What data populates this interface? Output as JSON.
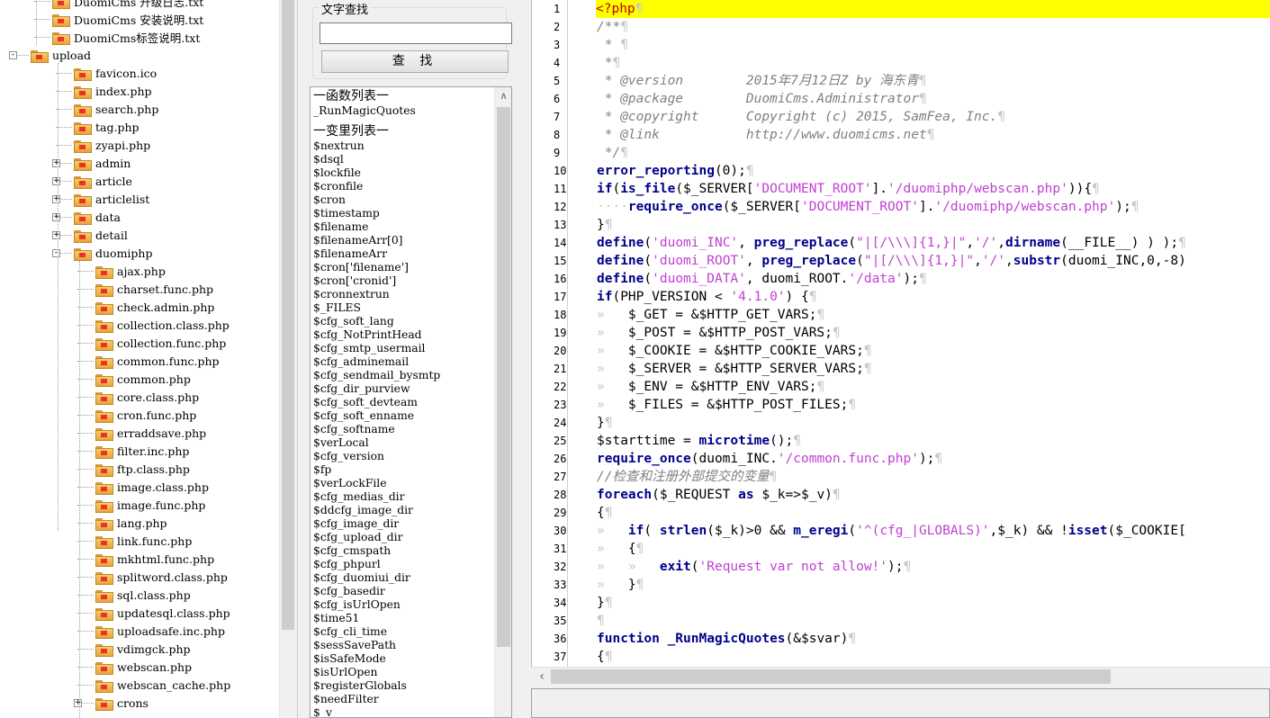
{
  "tree": {
    "items": [
      {
        "label": "DuomiCms 升级日志.txt",
        "indent": 2
      },
      {
        "label": "DuomiCms 安装说明.txt",
        "indent": 2
      },
      {
        "label": "DuomiCms标签说明.txt",
        "indent": 2
      },
      {
        "label": "upload",
        "indent": 1,
        "expander": "-"
      },
      {
        "label": "favicon.ico",
        "indent": 3
      },
      {
        "label": "index.php",
        "indent": 3
      },
      {
        "label": "search.php",
        "indent": 3
      },
      {
        "label": "tag.php",
        "indent": 3
      },
      {
        "label": "zyapi.php",
        "indent": 3
      },
      {
        "label": "admin",
        "indent": 3,
        "expander": "+"
      },
      {
        "label": "article",
        "indent": 3,
        "expander": "+"
      },
      {
        "label": "articlelist",
        "indent": 3,
        "expander": "+"
      },
      {
        "label": "data",
        "indent": 3,
        "expander": "+"
      },
      {
        "label": "detail",
        "indent": 3,
        "expander": "+"
      },
      {
        "label": "duomiphp",
        "indent": 3,
        "expander": "-"
      },
      {
        "label": "ajax.php",
        "indent": 4
      },
      {
        "label": "charset.func.php",
        "indent": 4
      },
      {
        "label": "check.admin.php",
        "indent": 4
      },
      {
        "label": "collection.class.php",
        "indent": 4
      },
      {
        "label": "collection.func.php",
        "indent": 4
      },
      {
        "label": "common.func.php",
        "indent": 4
      },
      {
        "label": "common.php",
        "indent": 4
      },
      {
        "label": "core.class.php",
        "indent": 4
      },
      {
        "label": "cron.func.php",
        "indent": 4
      },
      {
        "label": "erraddsave.php",
        "indent": 4
      },
      {
        "label": "filter.inc.php",
        "indent": 4
      },
      {
        "label": "ftp.class.php",
        "indent": 4
      },
      {
        "label": "image.class.php",
        "indent": 4
      },
      {
        "label": "image.func.php",
        "indent": 4
      },
      {
        "label": "lang.php",
        "indent": 4
      },
      {
        "label": "link.func.php",
        "indent": 4
      },
      {
        "label": "mkhtml.func.php",
        "indent": 4
      },
      {
        "label": "splitword.class.php",
        "indent": 4
      },
      {
        "label": "sql.class.php",
        "indent": 4
      },
      {
        "label": "updatesql.class.php",
        "indent": 4
      },
      {
        "label": "uploadsafe.inc.php",
        "indent": 4
      },
      {
        "label": "vdimgck.php",
        "indent": 4
      },
      {
        "label": "webscan.php",
        "indent": 4
      },
      {
        "label": "webscan_cache.php",
        "indent": 4
      },
      {
        "label": "crons",
        "indent": 4,
        "expander": "+"
      }
    ]
  },
  "search": {
    "group_label": "文字查找",
    "input_value": "",
    "button_label": "查 找"
  },
  "symbols": {
    "functions_header": "一函数列表一",
    "functions": [
      "_RunMagicQuotes"
    ],
    "variables_header": "一变里列表一",
    "variables": [
      "$nextrun",
      "$dsql",
      "$lockfile",
      "$cronfile",
      "$cron",
      "$timestamp",
      "$filename",
      "$filenameArr[0]",
      "$filenameArr",
      "$cron['filename']",
      "$cron['cronid']",
      "$cronnextrun",
      "$_FILES",
      "$cfg_soft_lang",
      "$cfg_NotPrintHead",
      "$cfg_smtp_usermail",
      "$cfg_adminemail",
      "$cfg_sendmail_bysmtp",
      "$cfg_dir_purview",
      "$cfg_soft_devteam",
      "$cfg_soft_enname",
      "$cfg_softname",
      "$verLocal",
      "$cfg_version",
      "$fp",
      "$verLockFile",
      "$cfg_medias_dir",
      "$ddcfg_image_dir",
      "$cfg_image_dir",
      "$cfg_upload_dir",
      "$cfg_cmspath",
      "$cfg_phpurl",
      "$cfg_duomiui_dir",
      "$cfg_basedir",
      "$cfg_isUrlOpen",
      "$time51",
      "$cfg_cli_time",
      "$sessSavePath",
      "$isSafeMode",
      "$isUrlOpen",
      "$registerGlobals",
      "$needFilter",
      "$_v"
    ]
  },
  "editor": {
    "line_numbers": [
      "1",
      "2",
      "3",
      "4",
      "5",
      "6",
      "7",
      "8",
      "9",
      "10",
      "11",
      "12",
      "13",
      "14",
      "15",
      "16",
      "17",
      "18",
      "19",
      "20",
      "21",
      "22",
      "23",
      "24",
      "25",
      "26",
      "27",
      "28",
      "29",
      "30",
      "31",
      "32",
      "33",
      "34",
      "35",
      "36",
      "37"
    ],
    "highlighted_line": 1,
    "lines": [
      [
        [
          "p",
          "<?php"
        ],
        [
          "ws",
          "¶"
        ]
      ],
      [
        [
          "c",
          "/**"
        ],
        [
          "ws",
          "¶"
        ]
      ],
      [
        [
          "c",
          " * "
        ],
        [
          "ws",
          "¶"
        ]
      ],
      [
        [
          "c",
          " *"
        ],
        [
          "ws",
          "¶"
        ]
      ],
      [
        [
          "c",
          " * @version        2015年7月12日Z by 海东青"
        ],
        [
          "ws",
          "¶"
        ]
      ],
      [
        [
          "c",
          " * @package        DuomiCms.Administrator"
        ],
        [
          "ws",
          "¶"
        ]
      ],
      [
        [
          "c",
          " * @copyright      Copyright (c) 2015, SamFea, Inc."
        ],
        [
          "ws",
          "¶"
        ]
      ],
      [
        [
          "c",
          " * @link           http://www.duomicms.net"
        ],
        [
          "ws",
          "¶"
        ]
      ],
      [
        [
          "c",
          " */"
        ],
        [
          "ws",
          "¶"
        ]
      ],
      [
        [
          "k",
          "error_reporting"
        ],
        [
          "v",
          "(0);"
        ],
        [
          "ws",
          "¶"
        ]
      ],
      [
        [
          "k",
          "if"
        ],
        [
          "v",
          "("
        ],
        [
          "k",
          "is_file"
        ],
        [
          "v",
          "($_SERVER["
        ],
        [
          "s",
          "'DOCUMENT_ROOT'"
        ],
        [
          "v",
          "]."
        ],
        [
          "s",
          "'/duomiphp/webscan.php'"
        ],
        [
          "v",
          "))"
        ],
        [
          "v",
          "{"
        ],
        [
          "ws",
          "¶"
        ]
      ],
      [
        [
          "ws",
          "····"
        ],
        [
          "k",
          "require_once"
        ],
        [
          "v",
          "($_SERVER["
        ],
        [
          "s",
          "'DOCUMENT_ROOT'"
        ],
        [
          "v",
          "]."
        ],
        [
          "s",
          "'/duomiphp/webscan.php'"
        ],
        [
          "v",
          ");"
        ],
        [
          "ws",
          "¶"
        ]
      ],
      [
        [
          "v",
          "}"
        ],
        [
          "ws",
          "¶"
        ]
      ],
      [
        [
          "k",
          "define"
        ],
        [
          "v",
          "("
        ],
        [
          "s",
          "'duomi_INC'"
        ],
        [
          "v",
          ", "
        ],
        [
          "k",
          "preg_replace"
        ],
        [
          "v",
          "("
        ],
        [
          "s",
          "\"|[/\\\\\\]{1,}|\""
        ],
        [
          "v",
          ","
        ],
        [
          "s",
          "'/'"
        ],
        [
          "v",
          ","
        ],
        [
          "k",
          "dirname"
        ],
        [
          "v",
          "(__FILE__) ) );"
        ],
        [
          "ws",
          "¶"
        ]
      ],
      [
        [
          "k",
          "define"
        ],
        [
          "v",
          "("
        ],
        [
          "s",
          "'duomi_ROOT'"
        ],
        [
          "v",
          ", "
        ],
        [
          "k",
          "preg_replace"
        ],
        [
          "v",
          "("
        ],
        [
          "s",
          "\"|[/\\\\\\]{1,}|\""
        ],
        [
          "v",
          ","
        ],
        [
          "s",
          "'/'"
        ],
        [
          "v",
          ","
        ],
        [
          "k",
          "substr"
        ],
        [
          "v",
          "(duomi_INC,0,-8)"
        ]
      ],
      [
        [
          "k",
          "define"
        ],
        [
          "v",
          "("
        ],
        [
          "s",
          "'duomi_DATA'"
        ],
        [
          "v",
          ", duomi_ROOT."
        ],
        [
          "s",
          "'/data'"
        ],
        [
          "v",
          ");"
        ],
        [
          "ws",
          "¶"
        ]
      ],
      [
        [
          "k",
          "if"
        ],
        [
          "v",
          "(PHP_VERSION < "
        ],
        [
          "s",
          "'4.1.0'"
        ],
        [
          "v",
          ") {"
        ],
        [
          "ws",
          "¶"
        ]
      ],
      [
        [
          "ws",
          "»   "
        ],
        [
          "v",
          "$_GET = &$HTTP_GET_VARS;"
        ],
        [
          "ws",
          "¶"
        ]
      ],
      [
        [
          "ws",
          "»   "
        ],
        [
          "v",
          "$_POST = &$HTTP_POST_VARS;"
        ],
        [
          "ws",
          "¶"
        ]
      ],
      [
        [
          "ws",
          "»   "
        ],
        [
          "v",
          "$_COOKIE = &$HTTP_COOKIE_VARS;"
        ],
        [
          "ws",
          "¶"
        ]
      ],
      [
        [
          "ws",
          "»   "
        ],
        [
          "v",
          "$_SERVER = &$HTTP_SERVER_VARS;"
        ],
        [
          "ws",
          "¶"
        ]
      ],
      [
        [
          "ws",
          "»   "
        ],
        [
          "v",
          "$_ENV = &$HTTP_ENV_VARS;"
        ],
        [
          "ws",
          "¶"
        ]
      ],
      [
        [
          "ws",
          "»   "
        ],
        [
          "v",
          "$_FILES = &$HTTP_POST_FILES;"
        ],
        [
          "ws",
          "¶"
        ]
      ],
      [
        [
          "v",
          "}"
        ],
        [
          "ws",
          "¶"
        ]
      ],
      [
        [
          "v",
          "$starttime = "
        ],
        [
          "k",
          "microtime"
        ],
        [
          "v",
          "();"
        ],
        [
          "ws",
          "¶"
        ]
      ],
      [
        [
          "k",
          "require_once"
        ],
        [
          "v",
          "(duomi_INC."
        ],
        [
          "s",
          "'/common.func.php'"
        ],
        [
          "v",
          ");"
        ],
        [
          "ws",
          "¶"
        ]
      ],
      [
        [
          "c",
          "//检查和注册外部提交的变量"
        ],
        [
          "ws",
          "¶"
        ]
      ],
      [
        [
          "k",
          "foreach"
        ],
        [
          "v",
          "($_REQUEST "
        ],
        [
          "k",
          "as"
        ],
        [
          "v",
          " $_k=>$_v)"
        ],
        [
          "ws",
          "¶"
        ]
      ],
      [
        [
          "v",
          "{"
        ],
        [
          "ws",
          "¶"
        ]
      ],
      [
        [
          "ws",
          "»   "
        ],
        [
          "k",
          "if"
        ],
        [
          "v",
          "( "
        ],
        [
          "k",
          "strlen"
        ],
        [
          "v",
          "($_k)>0 && "
        ],
        [
          "k",
          "m_eregi"
        ],
        [
          "v",
          "("
        ],
        [
          "s",
          "'^(cfg_|GLOBALS)'"
        ],
        [
          "v",
          ",$_k) && !"
        ],
        [
          "k",
          "isset"
        ],
        [
          "v",
          "($_COOKIE["
        ]
      ],
      [
        [
          "ws",
          "»   "
        ],
        [
          "v",
          "{"
        ],
        [
          "ws",
          "¶"
        ]
      ],
      [
        [
          "ws",
          "»   »   "
        ],
        [
          "k",
          "exit"
        ],
        [
          "v",
          "("
        ],
        [
          "s",
          "'Request var not allow!'"
        ],
        [
          "v",
          ");"
        ],
        [
          "ws",
          "¶"
        ]
      ],
      [
        [
          "ws",
          "»   "
        ],
        [
          "v",
          "}"
        ],
        [
          "ws",
          "¶"
        ]
      ],
      [
        [
          "v",
          "}"
        ],
        [
          "ws",
          "¶"
        ]
      ],
      [
        [
          "ws",
          "¶"
        ]
      ],
      [
        [
          "k",
          "function"
        ],
        [
          "v",
          " "
        ],
        [
          "k",
          "_RunMagicQuotes"
        ],
        [
          "v",
          "(&$svar)"
        ],
        [
          "ws",
          "¶"
        ]
      ],
      [
        [
          "v",
          "{"
        ],
        [
          "ws",
          "¶"
        ]
      ]
    ]
  }
}
